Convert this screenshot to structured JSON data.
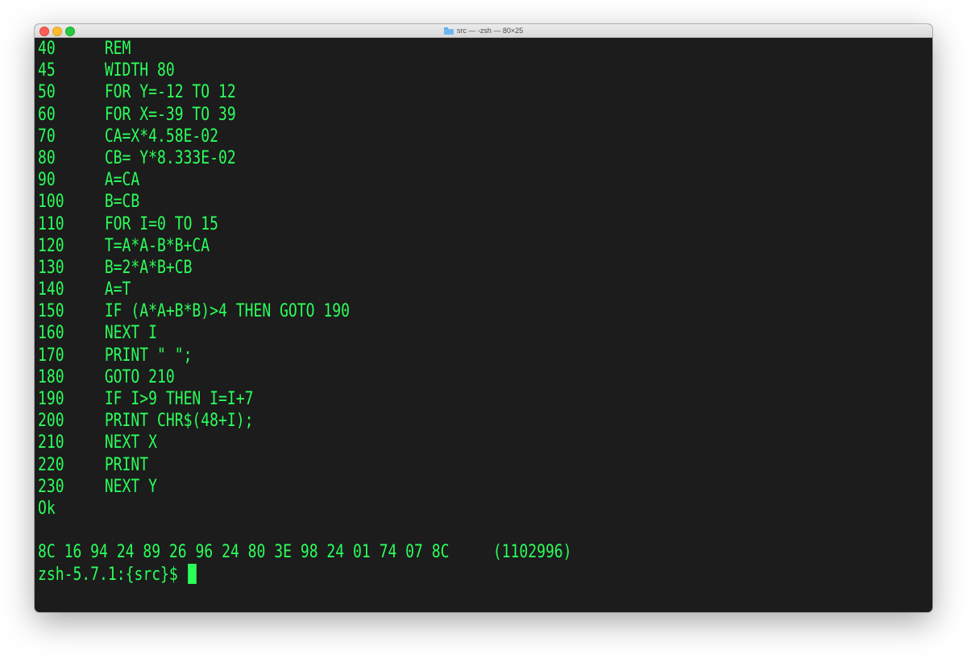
{
  "window": {
    "title": "src — -zsh — 80×25",
    "title_icon": "folder-icon",
    "buttons": [
      "close",
      "minimize",
      "zoom"
    ],
    "colors": {
      "background": "#1c1c1c",
      "text": "#2bff5a"
    }
  },
  "listing": [
    {
      "num": "40",
      "code": "REM"
    },
    {
      "num": "45",
      "code": "WIDTH 80"
    },
    {
      "num": "50",
      "code": "FOR Y=-12 TO 12"
    },
    {
      "num": "60",
      "code": "FOR X=-39 TO 39"
    },
    {
      "num": "70",
      "code": "CA=X*4.58E-02"
    },
    {
      "num": "80",
      "code": "CB= Y*8.333E-02"
    },
    {
      "num": "90",
      "code": "A=CA"
    },
    {
      "num": "100",
      "code": "B=CB"
    },
    {
      "num": "110",
      "code": "FOR I=0 TO 15"
    },
    {
      "num": "120",
      "code": "T=A*A-B*B+CA"
    },
    {
      "num": "130",
      "code": "B=2*A*B+CB"
    },
    {
      "num": "140",
      "code": "A=T"
    },
    {
      "num": "150",
      "code": "IF (A*A+B*B)>4 THEN GOTO 190"
    },
    {
      "num": "160",
      "code": "NEXT I"
    },
    {
      "num": "170",
      "code": "PRINT \" \";"
    },
    {
      "num": "180",
      "code": "GOTO 210"
    },
    {
      "num": "190",
      "code": "IF I>9 THEN I=I+7"
    },
    {
      "num": "200",
      "code": "PRINT CHR$(48+I);"
    },
    {
      "num": "210",
      "code": "NEXT X"
    },
    {
      "num": "220",
      "code": "PRINT"
    },
    {
      "num": "230",
      "code": "NEXT Y"
    }
  ],
  "status": "Ok",
  "hexdump": "8C 16 94 24 89 26 96 24 80 3E 98 24 01 74 07 8C     (1102996)",
  "prompt": "zsh-5.7.1:{src}$ "
}
